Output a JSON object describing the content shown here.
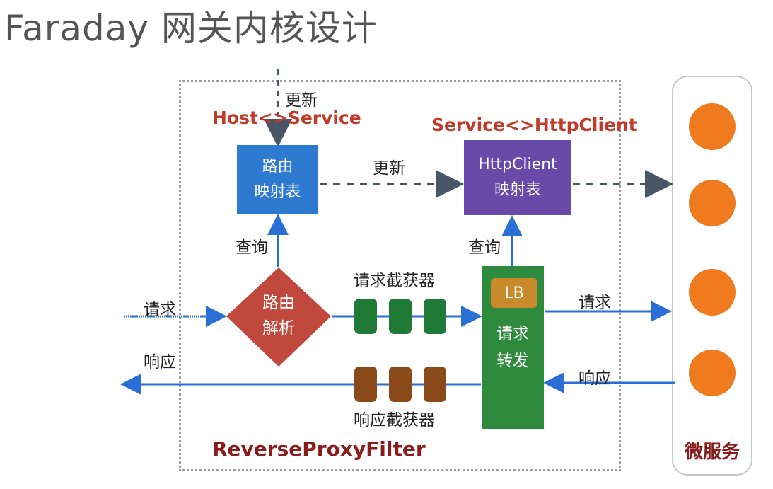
{
  "title": "Faraday 网关内核设计",
  "route_table": {
    "line1": "路由",
    "line2": "映射表"
  },
  "httpclient_table": {
    "line1": "HttpClient",
    "line2": "映射表"
  },
  "route_parse": {
    "line1": "路由",
    "line2": "解析"
  },
  "forward": {
    "lb": "LB",
    "line1": "请求",
    "line2": "转发"
  },
  "labels": {
    "update_top": "更新",
    "host_service": "Host<>Service",
    "update_mid": "更新",
    "service_httpclient": "Service<>HttpClient",
    "query_left": "查询",
    "query_right": "查询",
    "request_interceptor": "请求截获器",
    "response_interceptor": "响应截获器",
    "request_in": "请求",
    "response_out": "响应",
    "request_out": "请求",
    "response_in": "响应",
    "filter": "ReverseProxyFilter",
    "microservices": "微服务"
  },
  "colors": {
    "route_table": "#2f7ad1",
    "httpclient_table": "#6a4aa8",
    "route_parse": "#c0483d",
    "forward": "#2e8b3e",
    "lb": "#c98a2a",
    "request_chip": "#1e7a35",
    "response_chip": "#8a4a1a",
    "service": "#f07b1f",
    "flow_arrow": "#2a6fd6",
    "update_arrow": "#4a5568"
  }
}
